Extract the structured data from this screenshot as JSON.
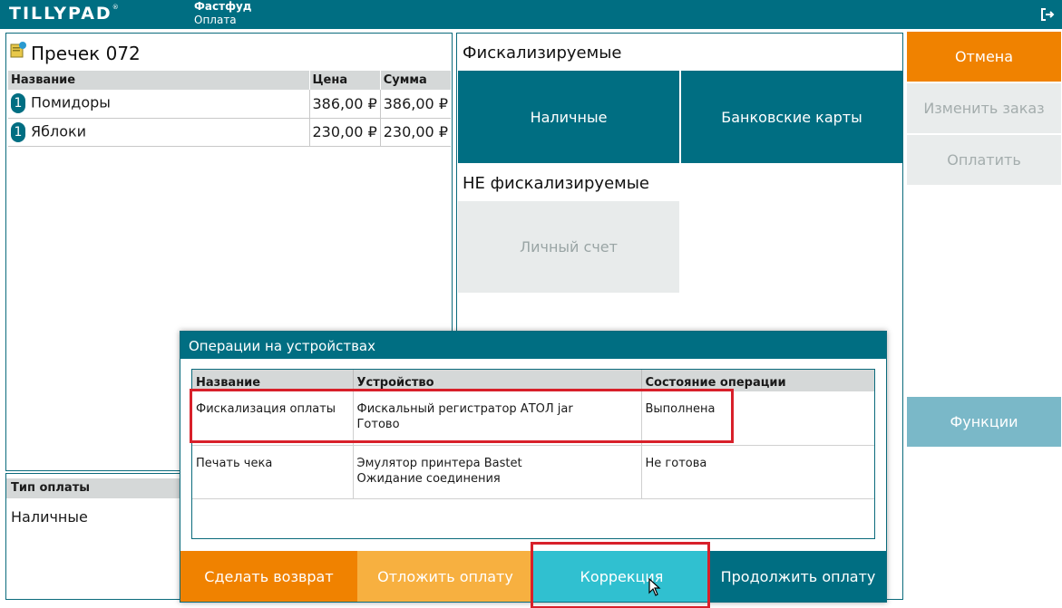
{
  "app": {
    "logo": "TILLYPAD",
    "logo_mark": "®",
    "section": "Фастфуд",
    "subsection": "Оплата"
  },
  "receipt": {
    "title": "Пречек 072",
    "columns": [
      "Название",
      "Цена",
      "Сумма"
    ],
    "rows": [
      {
        "qty": "1",
        "name": "Помидоры",
        "price": "386,00 ₽",
        "sum": "386,00 ₽"
      },
      {
        "qty": "1",
        "name": "Яблоки",
        "price": "230,00 ₽",
        "sum": "230,00 ₽"
      }
    ]
  },
  "payment_type": {
    "header": "Тип оплаты",
    "value": "Наличные"
  },
  "payment_methods": {
    "fiscal_title": "Фискализируемые",
    "fiscal_buttons": [
      "Наличные",
      "Банковские карты"
    ],
    "nonfiscal_title": "НЕ фискализируемые",
    "nonfiscal_buttons": [
      "Личный счет"
    ]
  },
  "actions": {
    "cancel": "Отмена",
    "change_order": "Изменить заказ",
    "pay": "Оплатить",
    "functions": "Функции"
  },
  "dialog": {
    "title": "Операции на устройствах",
    "columns": [
      "Название",
      "Устройство",
      "Состояние операции"
    ],
    "rows": [
      {
        "name": "Фискализация оплаты",
        "device": "Фискальный регистратор АТОЛ jar",
        "device_status": "Готово",
        "state": "Выполнена"
      },
      {
        "name": "Печать чека",
        "device": "Эмулятор принтера Bastet",
        "device_status": "Ожидание соединения",
        "state": "Не готова"
      }
    ],
    "buttons": {
      "return": "Сделать возврат",
      "postpone": "Отложить оплату",
      "correction": "Коррекция",
      "continue": "Продолжить оплату"
    }
  },
  "colors": {
    "brand_teal": "#006e82",
    "orange": "#f08200",
    "light_orange": "#f7b040",
    "cyan": "#30c0d0",
    "highlight_red": "#d8202a"
  }
}
